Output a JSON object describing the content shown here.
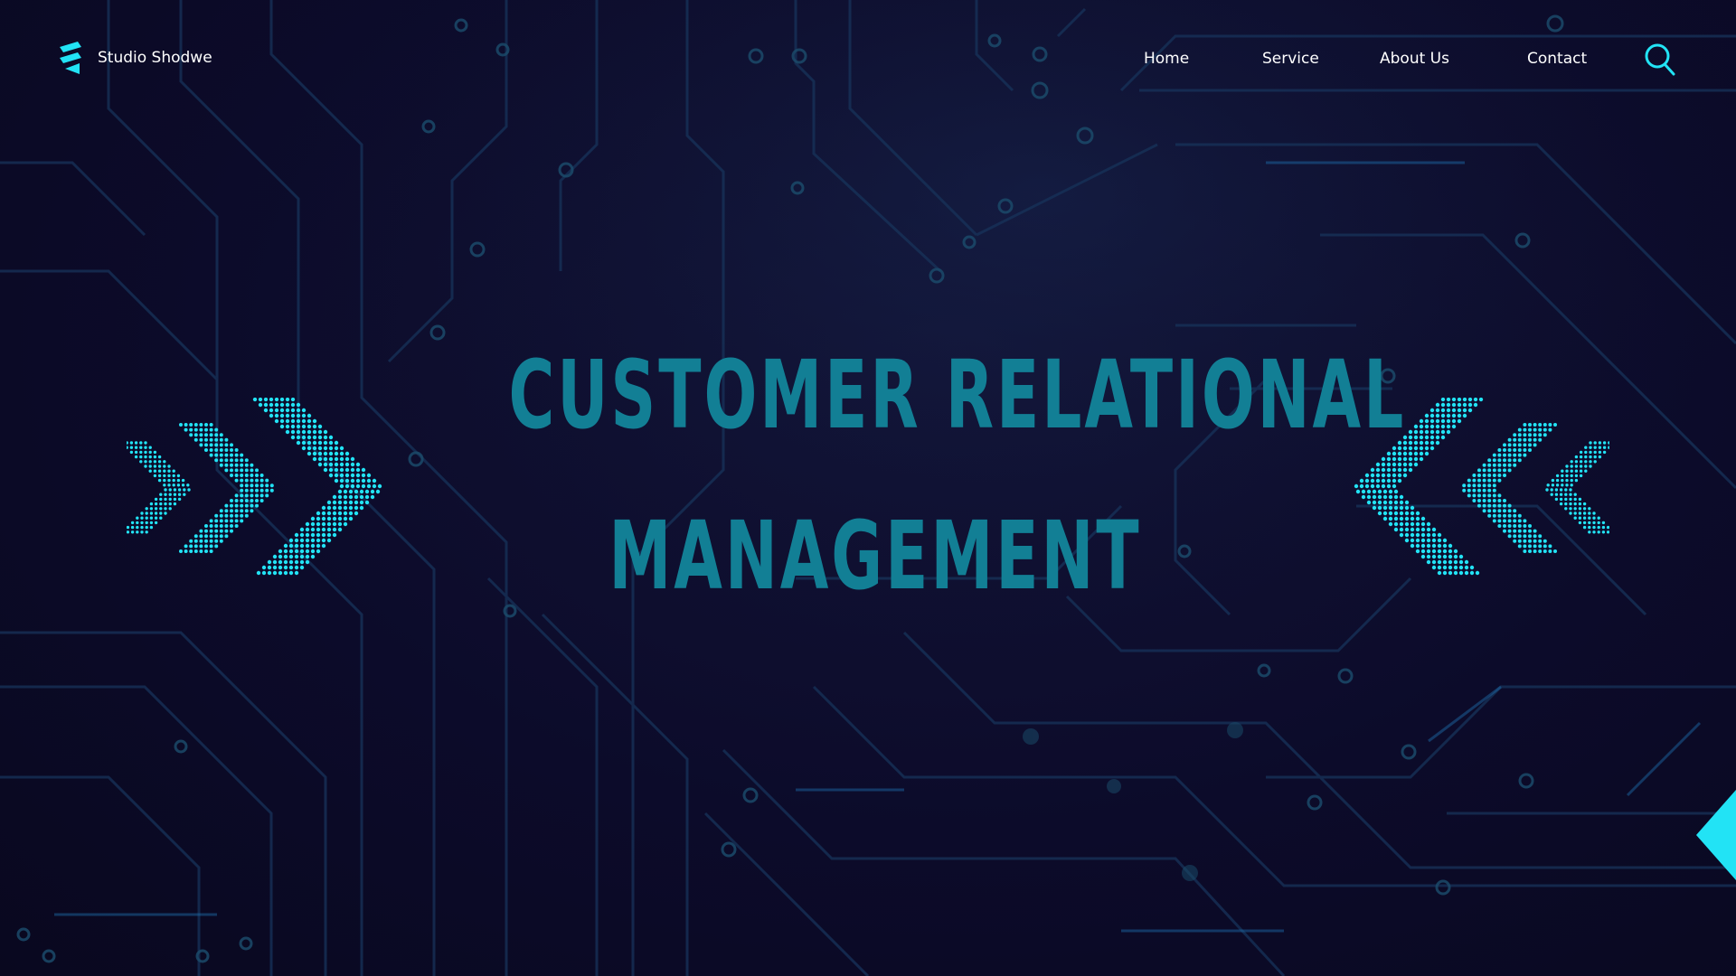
{
  "brand": {
    "name": "Studio Shodwe",
    "logo_icon": "layered-s-logo-icon"
  },
  "nav": {
    "items": [
      {
        "label": "Home"
      },
      {
        "label": "Service"
      },
      {
        "label": "About Us"
      },
      {
        "label": "Contact"
      }
    ],
    "search_icon": "search-icon"
  },
  "hero": {
    "line1": "CUSTOMER RELATIONAL",
    "line2": "MANAGEMENT"
  },
  "colors": {
    "background": "#0b0a26",
    "accent": "#22e3f5",
    "title": "#127f95",
    "circuit": "#1a3a5c"
  },
  "decor": {
    "left_icon": "dotted-chevrons-right-icon",
    "right_icon": "dotted-chevrons-left-icon",
    "corner_icon": "corner-triangle-icon"
  }
}
